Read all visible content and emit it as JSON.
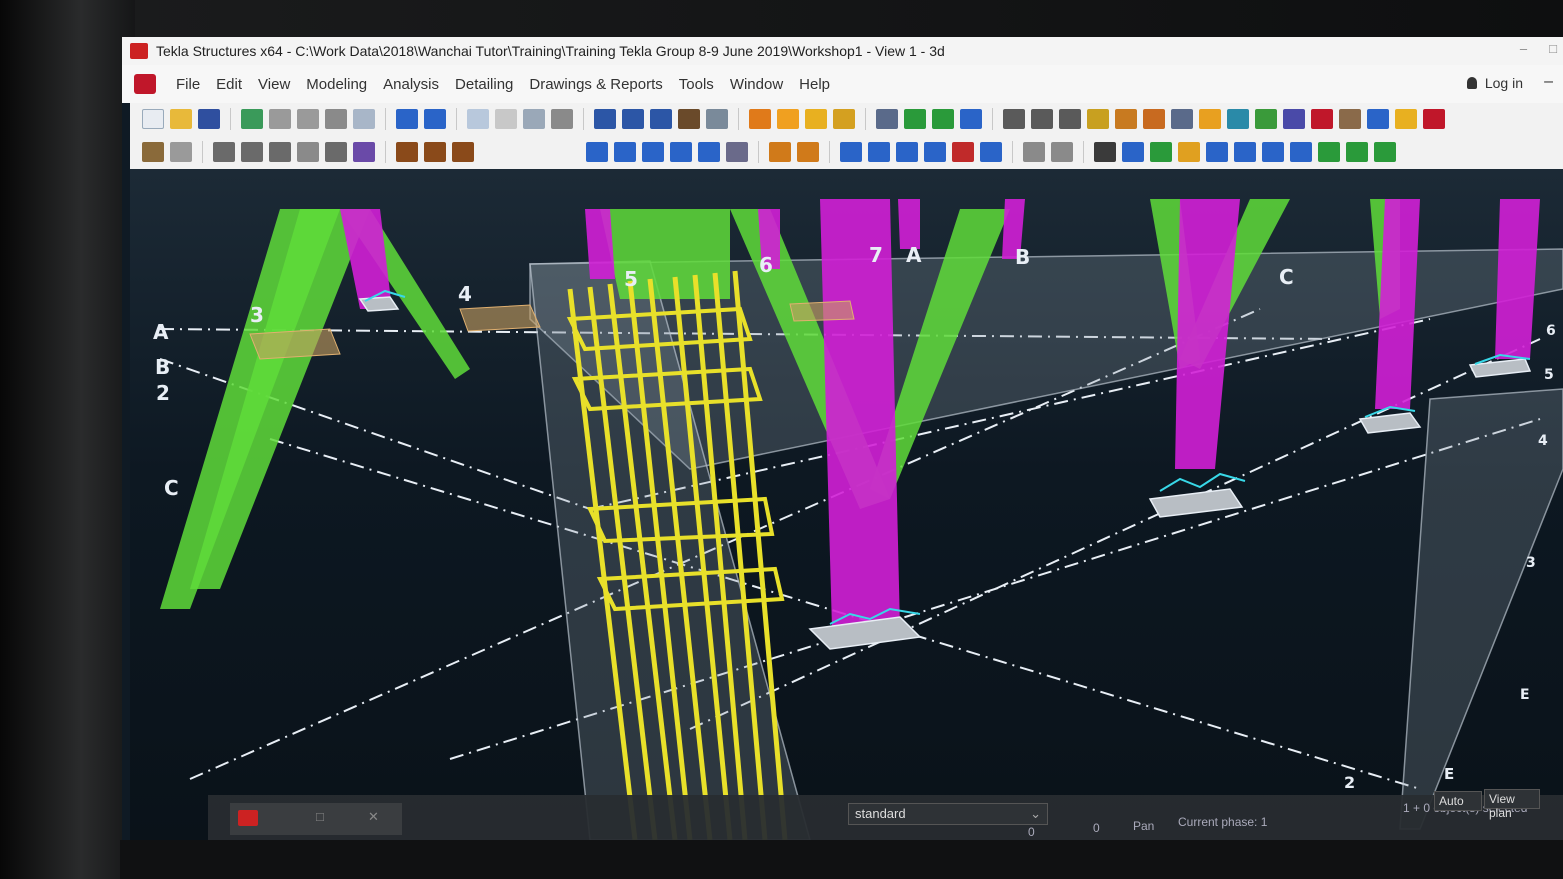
{
  "window": {
    "title": "Tekla Structures x64 - C:\\Work Data\\2018\\Wanchai Tutor\\Training\\Training Tekla Group 8-9 June 2019\\Workshop1  - View 1 - 3d",
    "minimize": "–",
    "maximize": "□"
  },
  "menu": {
    "items": [
      "File",
      "Edit",
      "View",
      "Modeling",
      "Analysis",
      "Detailing",
      "Drawings & Reports",
      "Tools",
      "Window",
      "Help"
    ],
    "login": "Log in",
    "collapse": "–"
  },
  "viewport": {
    "grid_labels": [
      "A",
      "B",
      "2",
      "3",
      "4",
      "5",
      "6",
      "7",
      "A",
      "B",
      "C",
      "C",
      "E",
      "E",
      "2",
      "3",
      "4",
      "5",
      "6"
    ]
  },
  "status": {
    "filter": "standard",
    "auto": "Auto",
    "view_plane": "View plan",
    "pan": "Pan",
    "current_phase": "Current phase: 1",
    "selection": "1 + 0 object(s) selected",
    "zero_a": "0",
    "zero_b": "0"
  },
  "colors": {
    "column_magenta": "#d21fd6",
    "brace_green": "#5fdc3a",
    "rebar_yellow": "#e8e02a",
    "slab_gray": "#9aa3ab"
  },
  "icons": {
    "app": "tekla-logo-icon",
    "login": "person-icon"
  }
}
